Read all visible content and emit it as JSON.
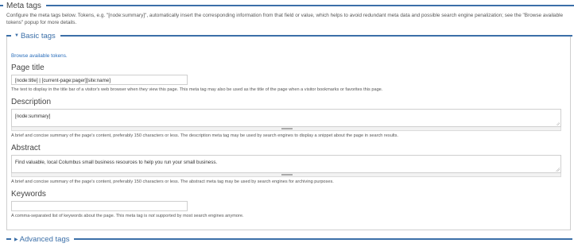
{
  "meta": {
    "title": "Meta tags",
    "description": "Configure the meta tags below. Tokens, e.g. \"[node:summary]\", automatically insert the corresponding information from that field or value, which helps to avoid redundant meta data and possible search engine penalization; see the \"Browse available tokens\" popup for more details."
  },
  "basic": {
    "title": "Basic tags",
    "browse_link": "Browse available tokens.",
    "page_title": {
      "label": "Page title",
      "value": "[node:title] | [current-page:pager][site:name]",
      "desc": "The text to display in the title bar of a visitor's web browser when they view this page. This meta tag may also be used as the title of the page when a visitor bookmarks or favorites this page."
    },
    "description": {
      "label": "Description",
      "value": "[node:summary]",
      "desc": "A brief and concise summary of the page's content, preferably 150 characters or less. The description meta tag may be used by search engines to display a snippet about the page in search results."
    },
    "abstract": {
      "label": "Abstract",
      "value": "Find valuable, local Columbus small business resources to help you run your small business.",
      "desc": "A brief and concise summary of the page's content, preferably 150 characters or less. The abstract meta tag may be used by search engines for archiving purposes."
    },
    "keywords": {
      "label": "Keywords",
      "value": "",
      "desc_before": "A comma-separated list of keywords about the page. This meta tag is ",
      "desc_em": "not",
      "desc_after": " supported by most search engines anymore."
    }
  },
  "advanced": {
    "title": "Advanced tags"
  },
  "colors": {
    "accent": "#3b6fa8",
    "link": "#2a6ebb"
  },
  "icons": {
    "expanded": "triangle-down-icon",
    "collapsed": "triangle-right-icon"
  }
}
